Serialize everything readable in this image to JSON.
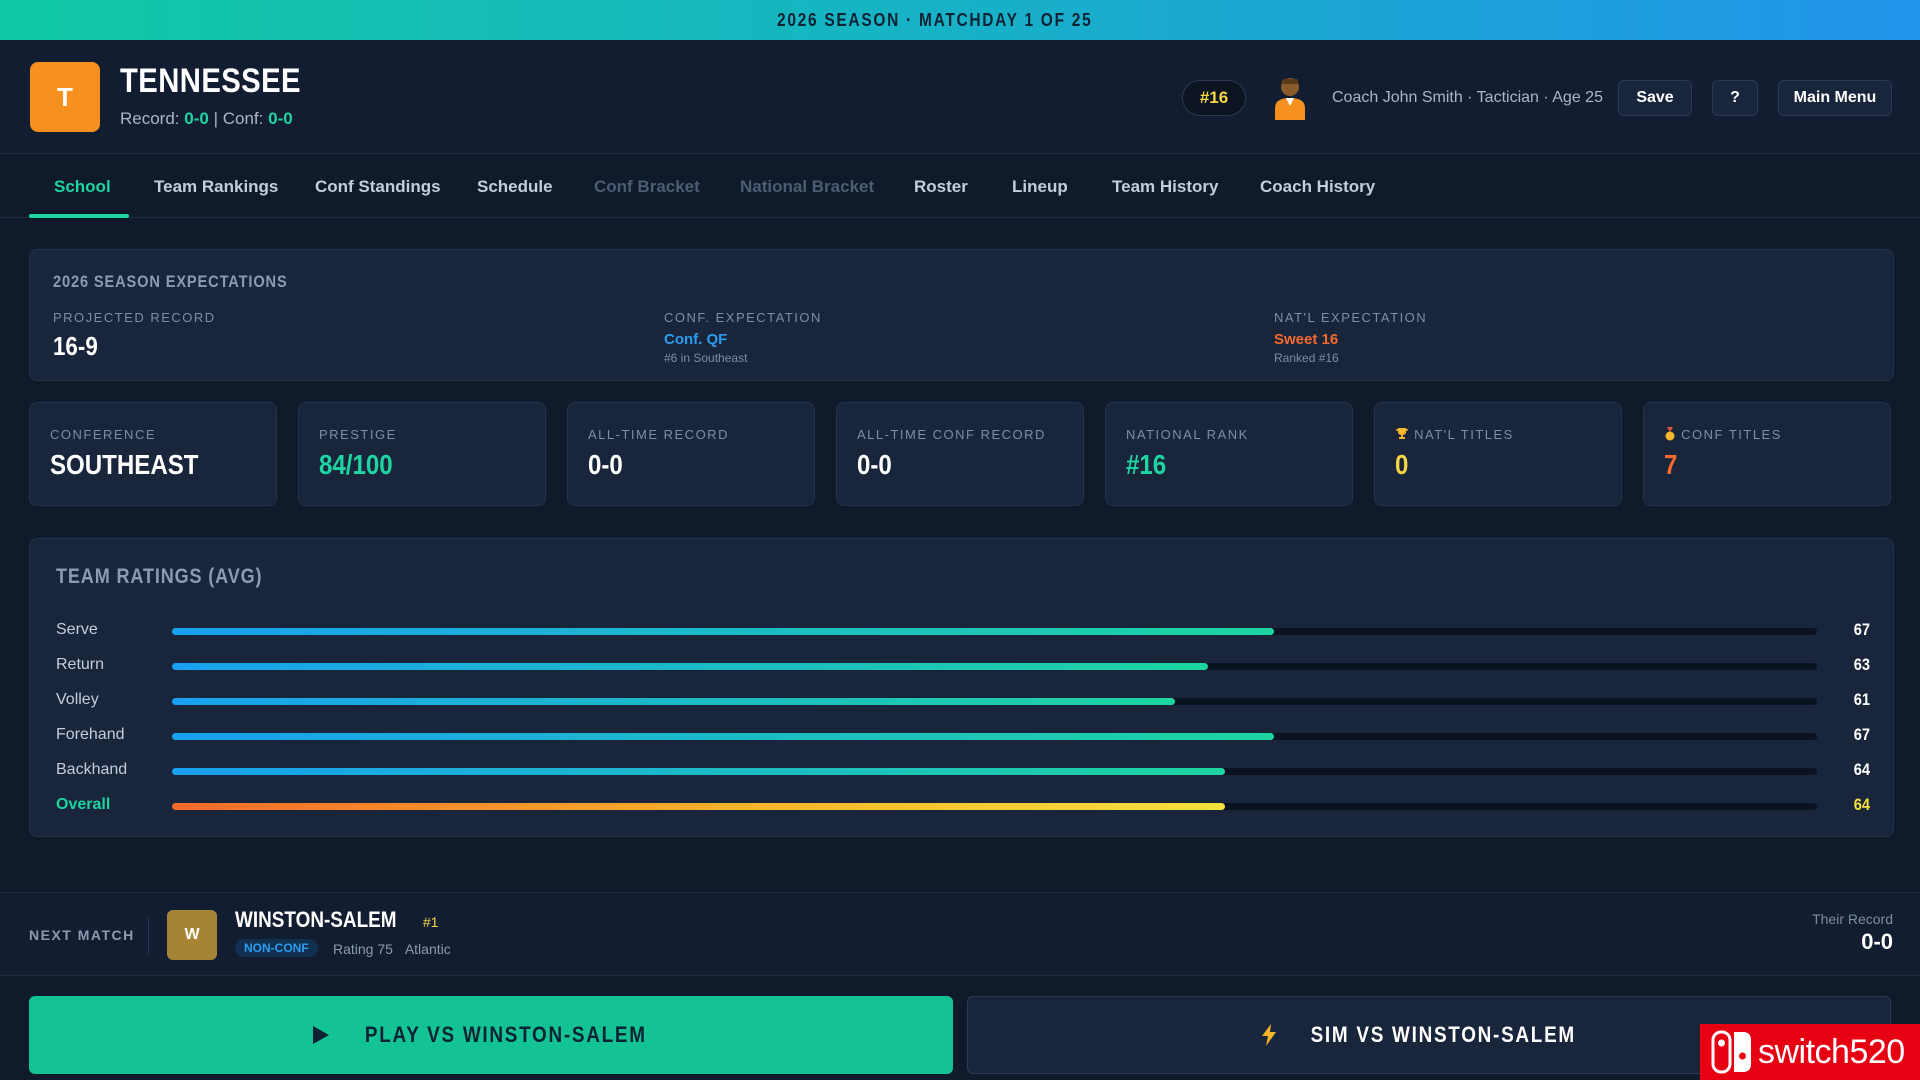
{
  "banner": {
    "text": "2026 SEASON · MATCHDAY 1 OF 25"
  },
  "team": {
    "logo_letter": "T",
    "name": "TENNESSEE",
    "record_label": "Record:",
    "record": "0-0",
    "separator": "|",
    "conf_label": "Conf:",
    "conf_record": "0-0",
    "rank_badge": "#16",
    "coach": "Coach John Smith · Tactician · Age 25",
    "colors": {
      "brand": "#f7901e",
      "accent": "#1ed4a0"
    }
  },
  "header_buttons": {
    "save": "Save",
    "help": "?",
    "main_menu": "Main Menu"
  },
  "tabs": [
    {
      "label": "School",
      "state": "active"
    },
    {
      "label": "Team Rankings",
      "state": "normal"
    },
    {
      "label": "Conf Standings",
      "state": "normal"
    },
    {
      "label": "Schedule",
      "state": "normal"
    },
    {
      "label": "Conf Bracket",
      "state": "disabled"
    },
    {
      "label": "National Bracket",
      "state": "disabled"
    },
    {
      "label": "Roster",
      "state": "normal"
    },
    {
      "label": "Lineup",
      "state": "normal"
    },
    {
      "label": "Team History",
      "state": "normal"
    },
    {
      "label": "Coach History",
      "state": "normal"
    }
  ],
  "expectations": {
    "title": "2026 SEASON EXPECTATIONS",
    "projected": {
      "label": "PROJECTED RECORD",
      "value": "16-9"
    },
    "conf": {
      "label": "CONF. EXPECTATION",
      "value": "Conf. QF",
      "sub": "#6 in Southeast"
    },
    "natl": {
      "label": "NAT'L EXPECTATION",
      "value": "Sweet 16",
      "sub": "Ranked #16"
    }
  },
  "stats": [
    {
      "label": "CONFERENCE",
      "value": "SOUTHEAST",
      "color": "#ffffff",
      "icon": ""
    },
    {
      "label": "PRESTIGE",
      "value": "84/100",
      "color": "#1ed4a0",
      "icon": ""
    },
    {
      "label": "ALL-TIME RECORD",
      "value": "0-0",
      "color": "#ffffff",
      "icon": ""
    },
    {
      "label": "ALL-TIME CONF RECORD",
      "value": "0-0",
      "color": "#ffffff",
      "icon": ""
    },
    {
      "label": "NATIONAL RANK",
      "value": "#16",
      "color": "#1ed4a0",
      "icon": ""
    },
    {
      "label": "NAT'L TITLES",
      "value": "0",
      "color": "#f6d646",
      "icon": "trophy-icon"
    },
    {
      "label": "CONF TITLES",
      "value": "7",
      "color": "#f76a2b",
      "icon": "medal-icon"
    }
  ],
  "ratings": {
    "title": "TEAM RATINGS (AVG)",
    "max": 100,
    "items": [
      {
        "name": "Serve",
        "value": 67
      },
      {
        "name": "Return",
        "value": 63
      },
      {
        "name": "Volley",
        "value": 61
      },
      {
        "name": "Forehand",
        "value": 67
      },
      {
        "name": "Backhand",
        "value": 64
      },
      {
        "name": "Overall",
        "value": 64,
        "overall": true
      }
    ]
  },
  "next_match": {
    "label": "NEXT MATCH",
    "opponent_logo": "W",
    "opponent": "WINSTON-SALEM",
    "seed": "#1",
    "tag": "NON-CONF",
    "rating": "Rating 75",
    "conference": "Atlantic",
    "their_record_label": "Their Record",
    "their_record": "0-0"
  },
  "actions": {
    "play": "PLAY VS WINSTON-SALEM",
    "sim": "SIM VS WINSTON-SALEM"
  },
  "watermark": {
    "text": "switch520"
  }
}
